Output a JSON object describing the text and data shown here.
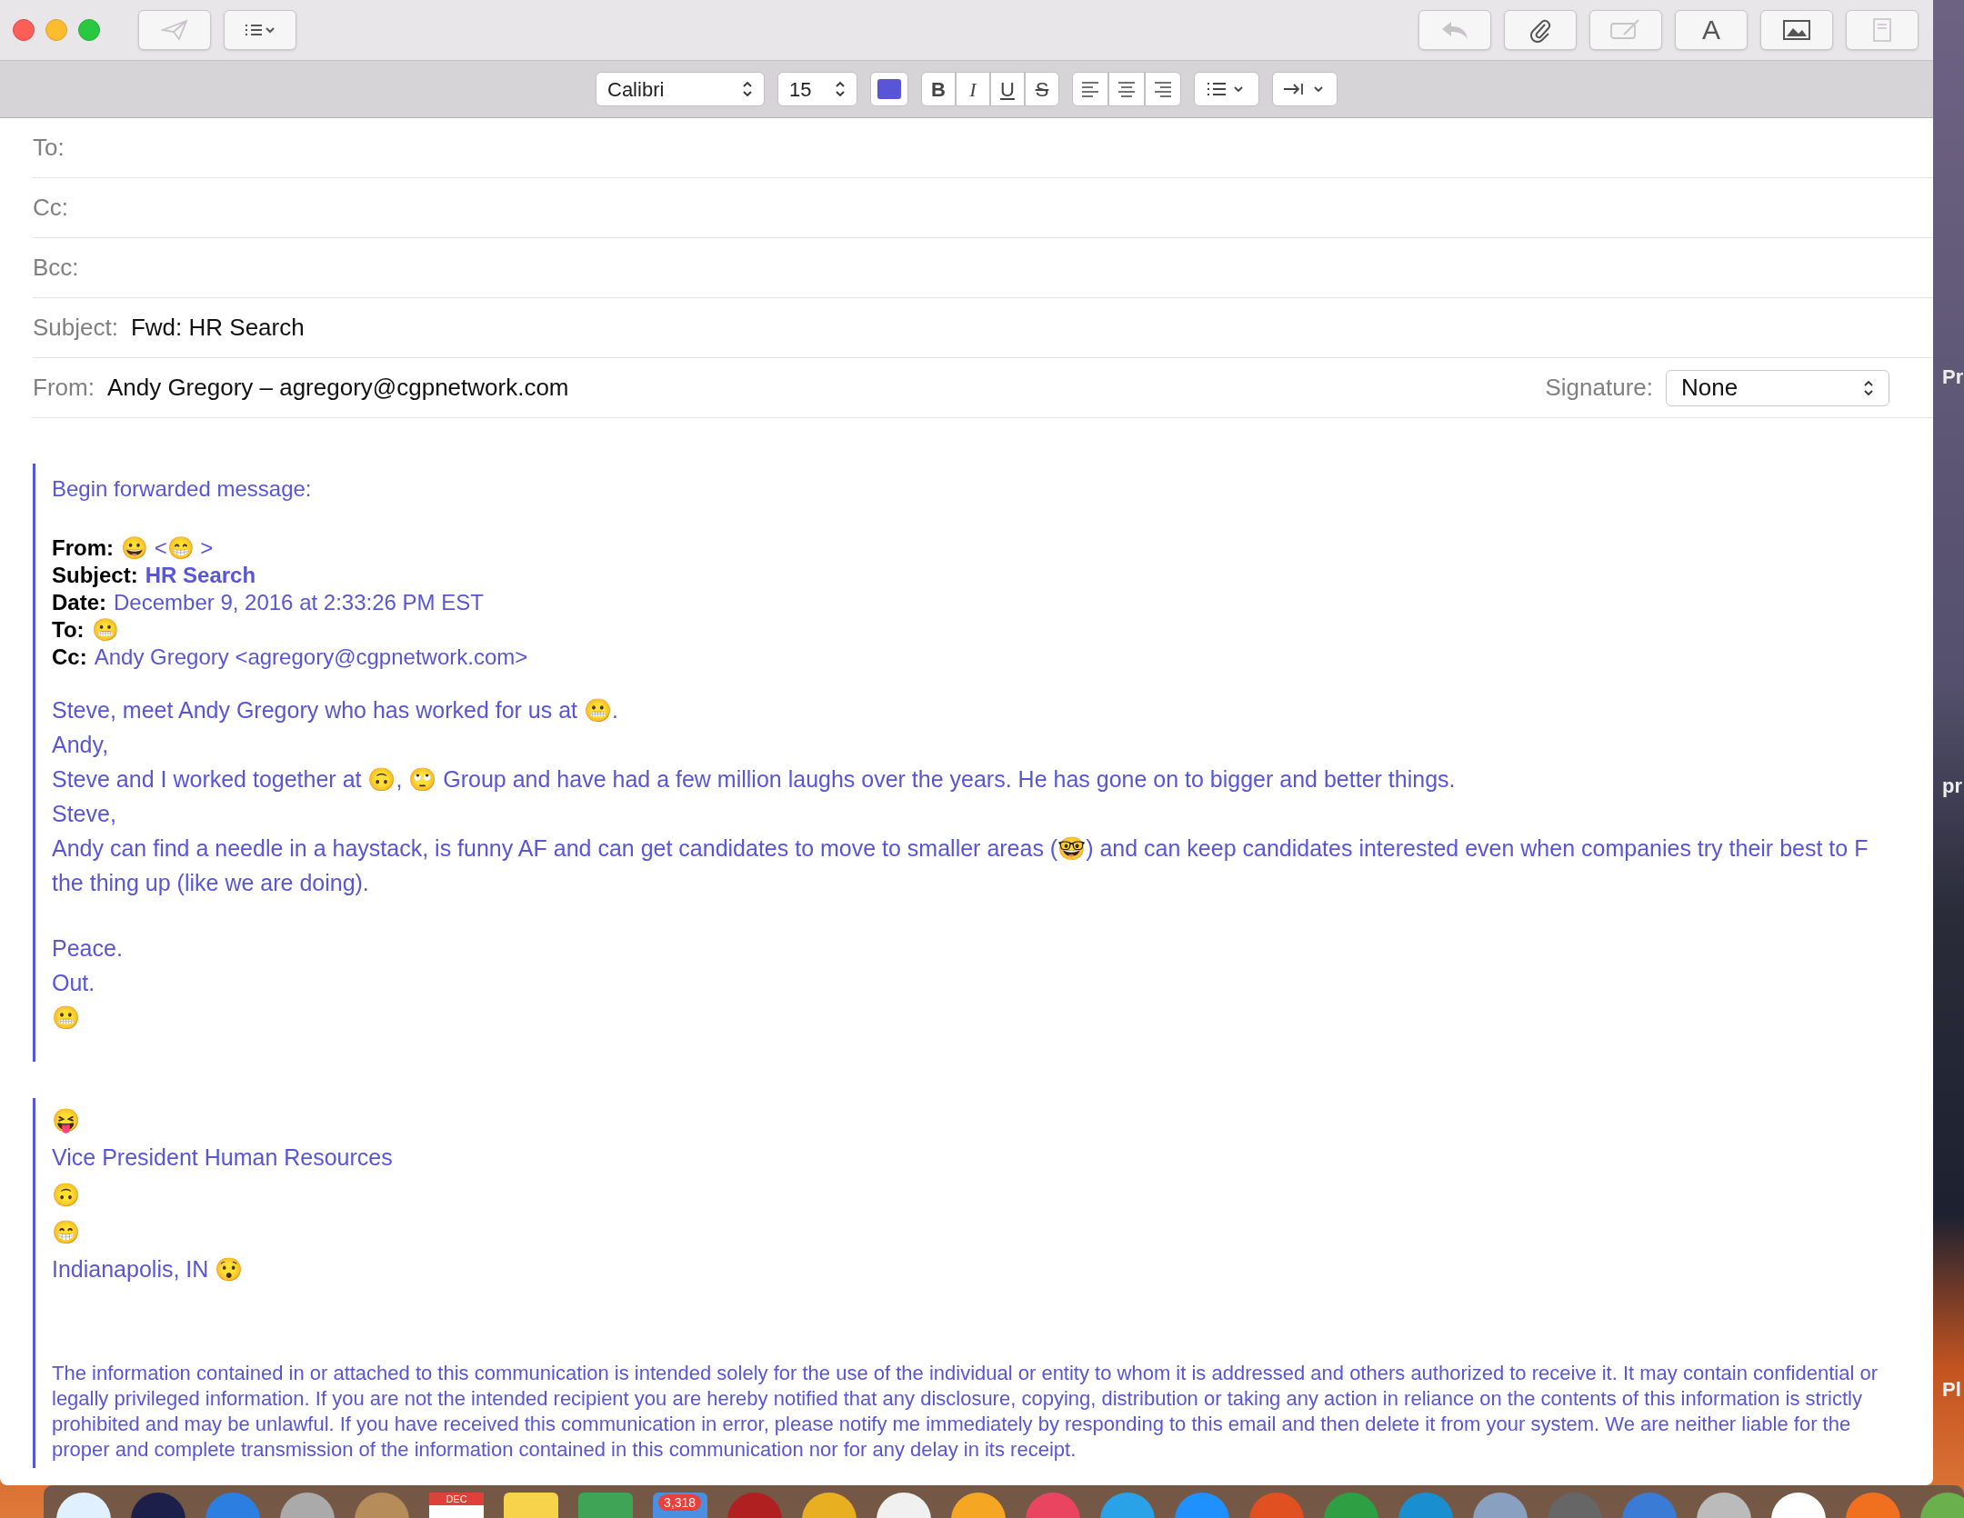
{
  "toolbar": {
    "left": [
      {
        "kind": "send",
        "disabled": true
      },
      {
        "kind": "header-fields",
        "disabled": false
      }
    ],
    "right": [
      {
        "kind": "reply",
        "disabled": true
      },
      {
        "kind": "attach",
        "disabled": false
      },
      {
        "kind": "markup",
        "disabled": true
      },
      {
        "kind": "fonts",
        "label": "A",
        "disabled": false
      },
      {
        "kind": "photos",
        "disabled": false
      },
      {
        "kind": "template",
        "disabled": true
      }
    ]
  },
  "format_bar": {
    "font": "Calibri",
    "size": "15",
    "styles": [
      {
        "kind": "bold",
        "label": "B"
      },
      {
        "kind": "italic",
        "label": "I"
      },
      {
        "kind": "underline",
        "label": "U"
      },
      {
        "kind": "strike",
        "label": "S"
      }
    ]
  },
  "header_fields": [
    {
      "label": "To:"
    },
    {
      "label": "Cc:"
    },
    {
      "label": "Bcc:"
    },
    {
      "label": "Subject:",
      "value": "Fwd: HR Search"
    },
    {
      "label": "From:",
      "value": "Andy Gregory – agregory@cgpnetwork.com"
    }
  ],
  "signature": {
    "label": "Signature:",
    "value": "None"
  },
  "forwarded": {
    "intro": "Begin forwarded message:",
    "fields": [
      {
        "label": "From:",
        "value": "😀  <😁 >",
        "bold": false
      },
      {
        "label": "Subject:",
        "value": "HR Search",
        "bold": true
      },
      {
        "label": "Date:",
        "value": "December 9, 2016 at 2:33:26 PM EST",
        "bold": false
      },
      {
        "label": "To:",
        "value": "😬"
      },
      {
        "label": "Cc:",
        "value": "Andy Gregory <agregory@cgpnetwork.com>",
        "bold": false
      }
    ],
    "lines": [
      "Steve, meet Andy Gregory who has worked for us at 😬.",
      "Andy,",
      "Steve and I worked together at 🙃, 🙄 Group and have had a few million laughs over the years. He has gone on to bigger and better things.",
      "Steve,",
      "Andy can find a needle in a haystack, is funny AF and can get candidates to move to smaller areas (🤓) and can keep candidates interested even when companies try their best to F the thing up (like we are doing)."
    ],
    "closing": [
      "Peace.",
      "Out.",
      "😬"
    ]
  },
  "sender_signature": [
    "😝",
    "Vice President Human Resources",
    "🙃",
    "😁",
    "Indianapolis, IN  😯"
  ],
  "disclaimer": "The information contained in or attached to this communication is intended solely for the use of the individual or entity to whom it is addressed and others authorized to receive it. It may contain confidential or legally privileged information. If you are not the intended recipient you are hereby notified that any disclosure, copying, distribution or taking any action in reliance on the contents of this information is strictly prohibited and may be unlawful. If you have received this communication in error, please notify me immediately by responding to this email and then delete it from your system. We are neither liable for the proper and complete transmission of the information contained in this communication nor for any delay in its receipt.",
  "desktop_labels": [
    "Pr",
    "pr",
    "Pl"
  ],
  "dock": {
    "calendar_month": "DEC",
    "mail_badge": "3,318"
  }
}
